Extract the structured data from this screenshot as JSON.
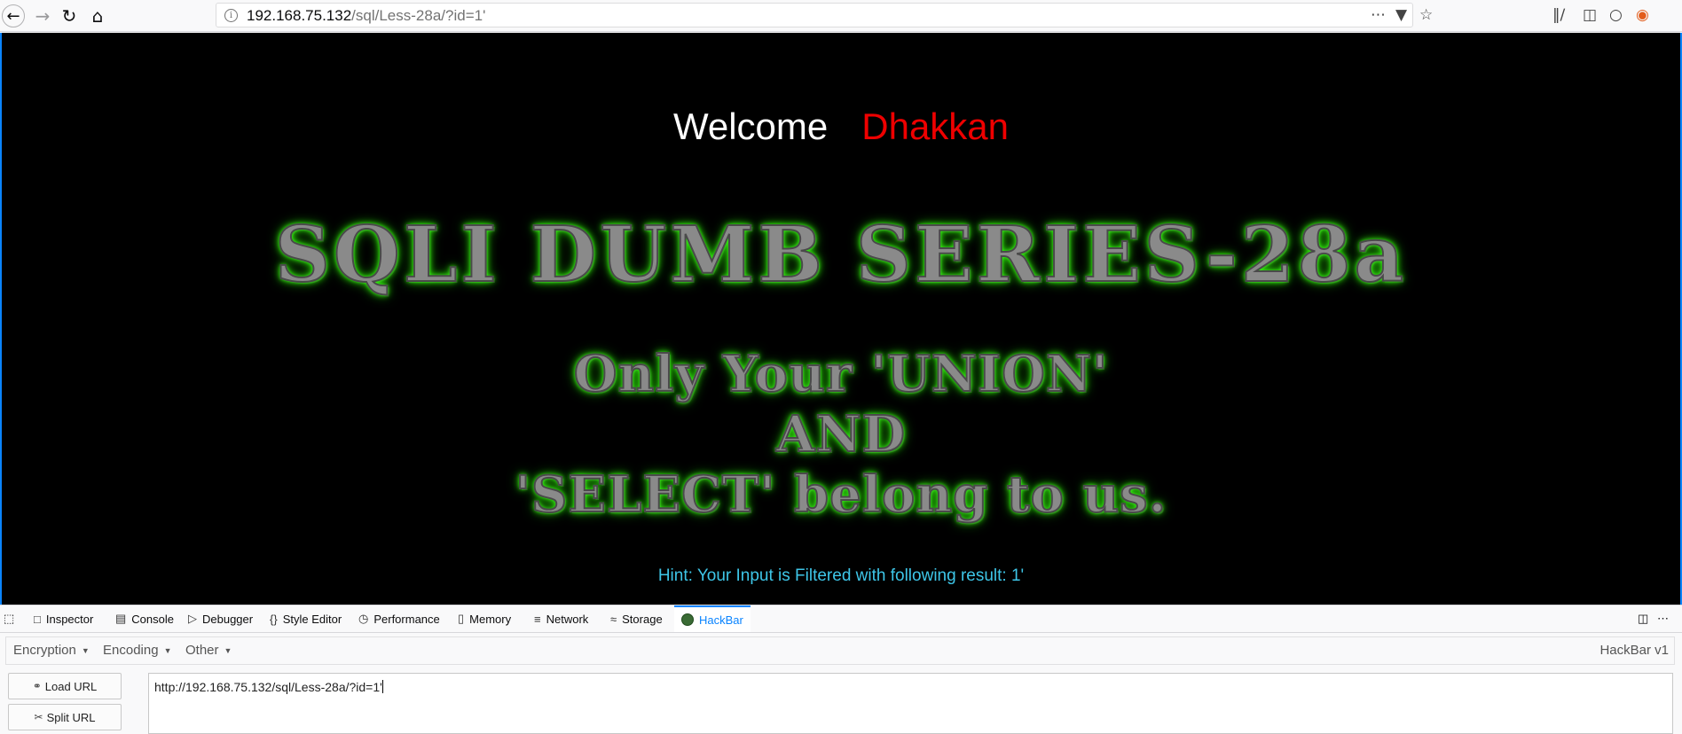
{
  "browser": {
    "url_host": "192.168.75.132",
    "url_path": "/sql/Less-28a/?id=1'"
  },
  "page": {
    "welcome": "Welcome",
    "welcome_name": "Dhakkan",
    "logo_title": "SQLI DUMB SERIES-28a",
    "logo_line1": "Only Your 'UNION'",
    "logo_line2": "AND",
    "logo_line3": "'SELECT' belong to us.",
    "hint": "Hint: Your Input is Filtered with following result: 1'"
  },
  "devtools": {
    "tabs": [
      {
        "label": "Inspector",
        "icon": "inspector-icon"
      },
      {
        "label": "Console",
        "icon": "console-icon"
      },
      {
        "label": "Debugger",
        "icon": "debugger-icon"
      },
      {
        "label": "Style Editor",
        "icon": "style-editor-icon"
      },
      {
        "label": "Performance",
        "icon": "performance-icon"
      },
      {
        "label": "Memory",
        "icon": "memory-icon"
      },
      {
        "label": "Network",
        "icon": "network-icon"
      },
      {
        "label": "Storage",
        "icon": "storage-icon"
      },
      {
        "label": "HackBar",
        "icon": "hackbar-icon"
      }
    ],
    "active_tab": "HackBar"
  },
  "hackbar": {
    "menu": [
      "Encryption",
      "Encoding",
      "Other"
    ],
    "version": "HackBar v1",
    "load_url": "Load URL",
    "split_url": "Split URL",
    "url_value": "http://192.168.75.132/sql/Less-28a/?id=1'"
  },
  "colors": {
    "accent": "#0a84ff",
    "welcome_name": "#ee0000",
    "hint": "#3ec6e8",
    "logo_glow": "#39ff14"
  }
}
